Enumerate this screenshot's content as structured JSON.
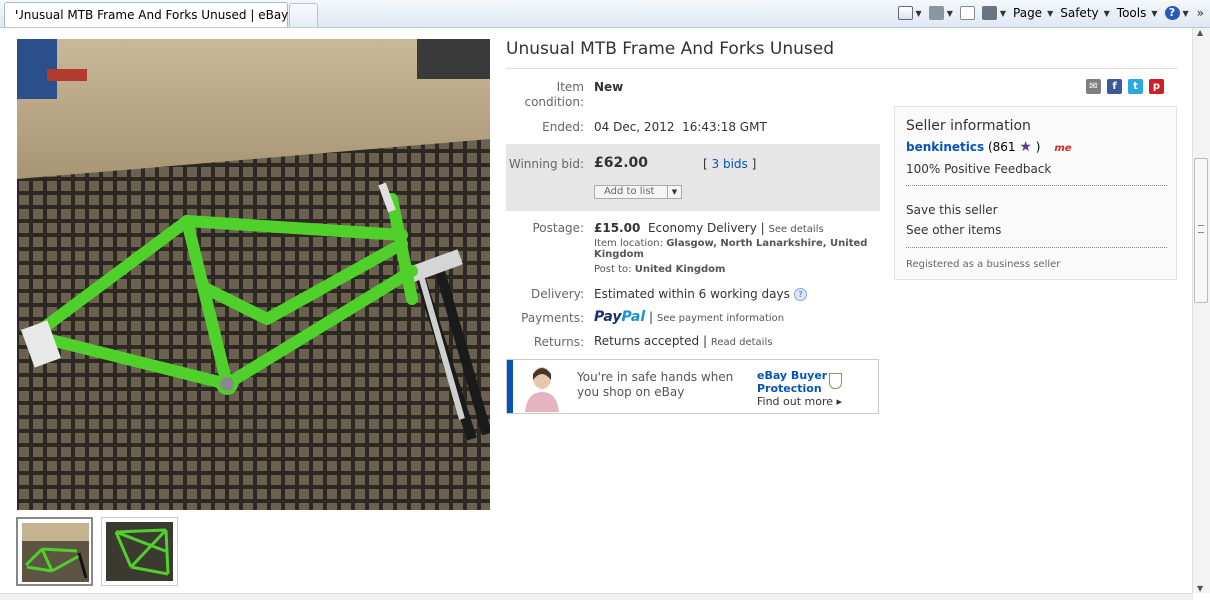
{
  "browser": {
    "tab_title": "Unusual MTB Frame And Forks Unused | eBay",
    "toolbar": {
      "page_label": "Page",
      "safety_label": "Safety",
      "tools_label": "Tools",
      "overflow": "»"
    }
  },
  "listing": {
    "title": "Unusual MTB Frame And Forks Unused",
    "condition_label": "Item condition:",
    "condition_value": "New",
    "ended_label": "Ended:",
    "ended_value": "04 Dec, 2012  16:43:18 GMT",
    "winning_bid_label": "Winning bid:",
    "winning_bid_value": "£62.00",
    "bids_open": "[",
    "bids_link": "3 bids",
    "bids_close": "]",
    "add_to_list": "Add to list",
    "postage_label": "Postage:",
    "postage_price": "£15.00",
    "postage_service": "Economy Delivery |",
    "postage_details_link": "See details",
    "item_location_label": "Item location:",
    "item_location_value": "Glasgow, North Lanarkshire, United Kingdom",
    "post_to_label": "Post to:",
    "post_to_value": "United Kingdom",
    "delivery_label": "Delivery:",
    "delivery_value": "Estimated within 6 working days",
    "payments_label": "Payments:",
    "paypal_pay": "Pay",
    "paypal_pal": "Pal",
    "payments_sep": "|",
    "payments_link": "See payment information",
    "returns_label": "Returns:",
    "returns_value": "Returns accepted |",
    "returns_link": "Read details"
  },
  "banner": {
    "line1": "You're in safe hands when",
    "line2": "you shop on eBay",
    "bp_title_1": "eBay Buyer",
    "bp_title_2": "Protection",
    "bp_link": "Find out more ▸"
  },
  "seller": {
    "heading": "Seller information",
    "username": "benkinetics",
    "score_open": "(861",
    "score_close": ")",
    "me_badge": "me",
    "feedback": "100% Positive Feedback",
    "save_seller": "Save this seller",
    "other_items": "See other items",
    "registered": "Registered as a business seller"
  },
  "social": [
    {
      "name": "email-share-icon",
      "glyph": "✉",
      "color": "#7f7f7f"
    },
    {
      "name": "facebook-share-icon",
      "glyph": "f",
      "color": "#3b5998"
    },
    {
      "name": "twitter-share-icon",
      "glyph": "t",
      "color": "#2aa9e0"
    },
    {
      "name": "pinterest-share-icon",
      "glyph": "p",
      "color": "#cb2027"
    }
  ],
  "colors": {
    "link": "#0654ba",
    "frame_green": "#4fd02a",
    "bid_box": "#e6e6e6"
  }
}
